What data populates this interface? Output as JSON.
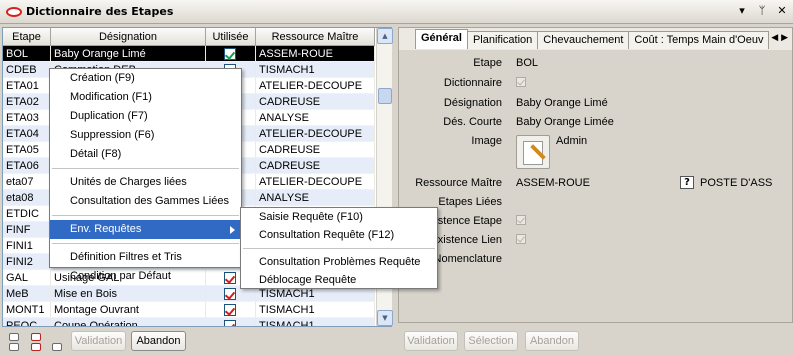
{
  "window": {
    "title": "Dictionnaire des Etapes",
    "buttons": [
      "▾",
      "ᛘ",
      "✕"
    ]
  },
  "grid": {
    "columns": [
      "Etape",
      "Désignation",
      "Utilisée",
      "Ressource Maître"
    ],
    "rows": [
      {
        "etape": "BOL",
        "designation": "Baby Orange Limé",
        "used": true,
        "ressource": "ASSEM-ROUE",
        "selected": true
      },
      {
        "etape": "CDEB",
        "designation": "Commation DEB...",
        "used": true,
        "ressource": "TISMACH1"
      },
      {
        "etape": "ETA01",
        "designation": "",
        "used": true,
        "ressource": "ATELIER-DECOUPE"
      },
      {
        "etape": "ETA02",
        "designation": "",
        "used": true,
        "ressource": "CADREUSE"
      },
      {
        "etape": "ETA03",
        "designation": "",
        "used": true,
        "ressource": "ANALYSE"
      },
      {
        "etape": "ETA04",
        "designation": "",
        "used": true,
        "ressource": "ATELIER-DECOUPE"
      },
      {
        "etape": "ETA05",
        "designation": "",
        "used": true,
        "ressource": "CADREUSE"
      },
      {
        "etape": "ETA06",
        "designation": "",
        "used": true,
        "ressource": "CADREUSE"
      },
      {
        "etape": "eta07",
        "designation": "",
        "used": true,
        "ressource": "ATELIER-DECOUPE"
      },
      {
        "etape": "eta08",
        "designation": "",
        "used": true,
        "ressource": "ANALYSE"
      },
      {
        "etape": "ETDIC",
        "designation": "",
        "used": true,
        "ressource": ""
      },
      {
        "etape": "FINF",
        "designation": "",
        "used": true,
        "ressource": ""
      },
      {
        "etape": "FINI1",
        "designation": "",
        "used": true,
        "ressource": ""
      },
      {
        "etape": "FINI2",
        "designation": "",
        "used": true,
        "ressource": ""
      },
      {
        "etape": "GAL",
        "designation": "Usinage GAL",
        "used": true,
        "ressource": ""
      },
      {
        "etape": "MeB",
        "designation": "Mise en Bois",
        "used": true,
        "ressource": "TISMACH1"
      },
      {
        "etape": "MONT1",
        "designation": "Montage Ouvrant",
        "used": true,
        "ressource": "TISMACH1"
      },
      {
        "etape": "PEOC",
        "designation": "Coupe Opération",
        "used": true,
        "ressource": "TISMACH1"
      }
    ]
  },
  "context_menu": {
    "items": [
      "Création (F9)",
      "Modification (F1)",
      "Duplication (F7)",
      "Suppression (F6)",
      "Détail (F8)",
      "Unités de Charges liées",
      "Consultation des Gammes Liées",
      "Env. Requêtes",
      "Définition Filtres et Tris",
      "Condition par Défaut"
    ]
  },
  "submenu": {
    "items": [
      "Saisie Requête (F10)",
      "Consultation Requête (F12)",
      "Consultation Problèmes Requête",
      "Déblocage Requête"
    ]
  },
  "left_buttons": {
    "validation": "Validation",
    "abandon": "Abandon"
  },
  "tabs": [
    "Général",
    "Planification",
    "Chevauchement",
    "Coût : Temps Main d'Oeuv"
  ],
  "form": {
    "labels": {
      "etape": "Etape",
      "dictionnaire": "Dictionnaire",
      "designation": "Désignation",
      "des_courte": "Dés. Courte",
      "image": "Image",
      "ressource": "Ressource Maître",
      "etapes_liees": "Etapes Liées",
      "existence_etape": "Existence Etape",
      "existence_lien": "Existence Lien",
      "nomenclature": "Nomenclature"
    },
    "values": {
      "etape": "BOL",
      "designation": "Baby Orange Limé",
      "des_courte": "Baby Orange Limée",
      "image_owner": "Admin",
      "ressource": "ASSEM-ROUE",
      "ressource_desc": "POSTE D'ASS"
    }
  },
  "right_buttons": {
    "validation": "Validation",
    "selection": "Sélection",
    "abandon": "Abandon"
  }
}
